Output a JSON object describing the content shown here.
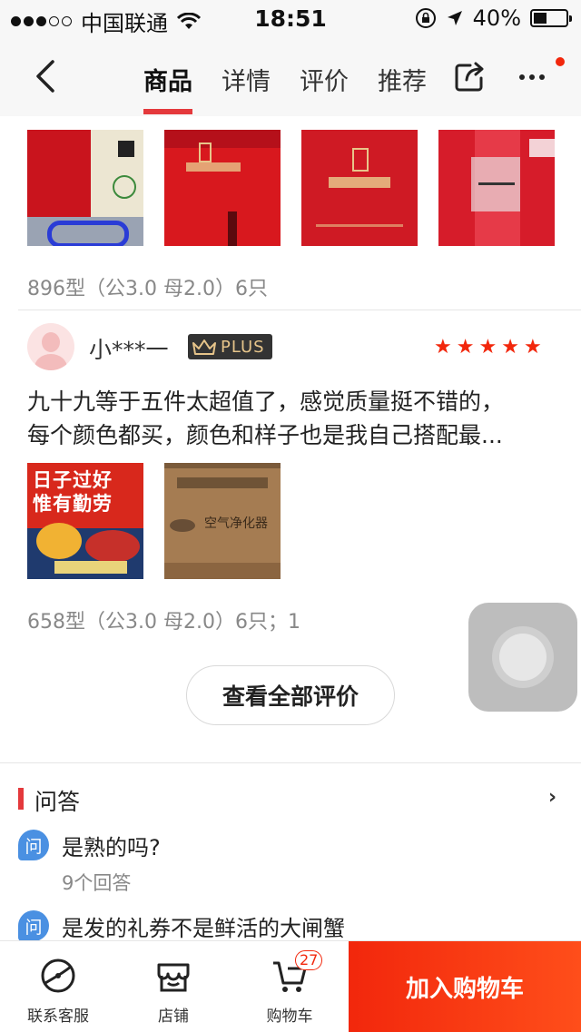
{
  "status_bar": {
    "carrier": "中国联通",
    "time": "18:51",
    "battery": "40%",
    "battery_level": 0.4
  },
  "nav": {
    "tabs": [
      {
        "label": "商品",
        "active": true
      },
      {
        "label": "详情",
        "active": false
      },
      {
        "label": "评价",
        "active": false
      },
      {
        "label": "推荐",
        "active": false
      }
    ]
  },
  "reviews": [
    {
      "images": [
        "red-gift-box-with-card",
        "red-gift-box-cover",
        "red-gift-box-gold-logo",
        "red-gift-card-1258"
      ],
      "spec": "896型（公3.0 母2.0）6只"
    },
    {
      "user": "小***一",
      "badge": "PLUS",
      "rating": 5,
      "text_line1": "九十九等于五件太超值了，感觉质量挺不错的，",
      "text_line2": "每个颜色都买，颜色和样子也是我自己搭配最...",
      "images": [
        "poster-日子过好惟有勤劳",
        "boxed-air-purifier"
      ],
      "poster_text_1": "日子过好",
      "poster_text_2": "惟有勤劳",
      "box_text": "空气净化器",
      "spec": "658型（公3.0 母2.0）6只；1"
    }
  ],
  "see_all_label": "查看全部评价",
  "qa": {
    "title": "问答",
    "icon_label": "问",
    "items": [
      {
        "question": "是熟的吗?",
        "answers": "9个回答"
      },
      {
        "question": "是发的礼券不是鲜活的大闸蟹"
      }
    ]
  },
  "bottom_bar": {
    "service": "联系客服",
    "store": "店铺",
    "cart": "购物车",
    "cart_count": "27",
    "add_to_cart": "加入购物车"
  },
  "colors": {
    "accent": "#e4393c",
    "cta": "#f2270c",
    "qa_icon": "#4a90e2"
  }
}
